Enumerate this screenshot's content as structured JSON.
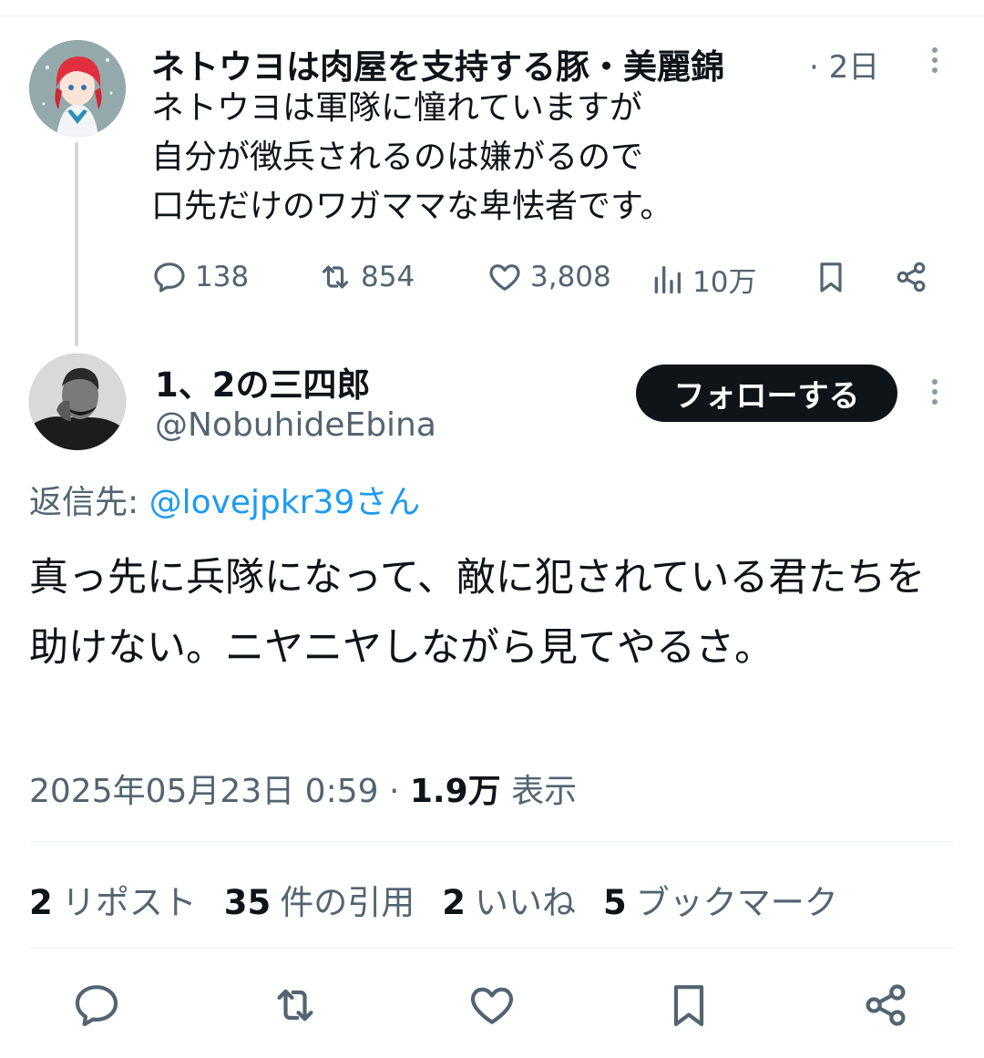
{
  "parent_tweet": {
    "display_name": "ネトウヨは肉屋を支持する豚・美麗錦",
    "time": "· 2日",
    "text": "ネトウヨは軍隊に憧れていますが\n自分が徴兵されるのは嫌がるので\n口先だけのワガママな卑怯者です。",
    "metrics": {
      "replies": "138",
      "reposts": "854",
      "likes": "3,808",
      "views": "10万"
    }
  },
  "reply_tweet": {
    "display_name": "1、2の三四郎",
    "handle": "@NobuhideEbina",
    "follow_label": "フォローする",
    "reply_prefix": "返信先: ",
    "reply_to": "@lovejpkr39さん",
    "text": "真っ先に兵隊になって、敵に犯されている君たちを助けない。ニヤニヤしながら見てやるさ。",
    "datetime": "2025年05月23日 0:59 · ",
    "views_count": "1.9万",
    "views_label": " 表示"
  },
  "stats": [
    {
      "count": "2",
      "label": "リポスト"
    },
    {
      "count": "35",
      "label": "件の引用"
    },
    {
      "count": "2",
      "label": "いいね"
    },
    {
      "count": "5",
      "label": "ブックマーク"
    }
  ],
  "colors": {
    "text": "#0f1419",
    "muted": "#536471",
    "link": "#1d9bf0",
    "divider": "#eff3f4",
    "thread_line": "#cfd9de",
    "button_bg": "#0f1419"
  },
  "icons": [
    "reply-icon",
    "repost-icon",
    "like-icon",
    "views-icon",
    "bookmark-icon",
    "share-icon",
    "more-icon"
  ]
}
